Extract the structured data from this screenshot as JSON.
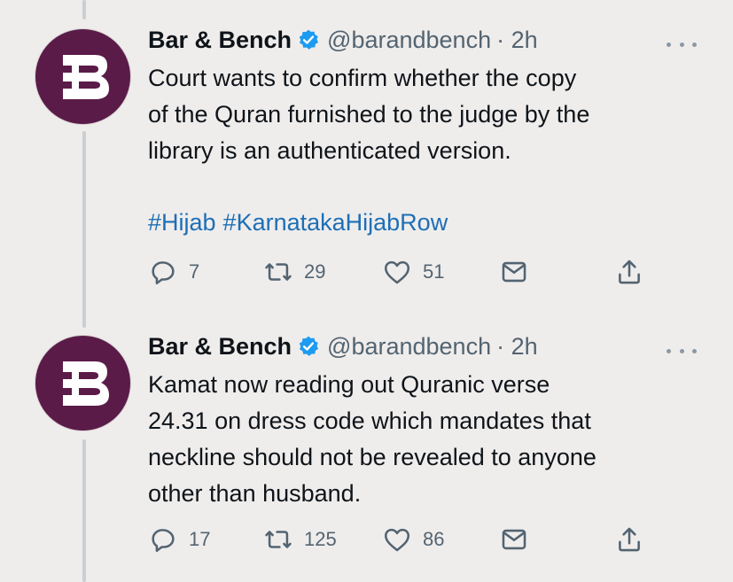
{
  "tweets": [
    {
      "author": "Bar & Bench",
      "handle": "@barandbench",
      "time": "· 2h",
      "text": "Court wants to confirm whether the copy\nof the Quran furnished to the judge by the\nlibrary is an authenticated version.",
      "hashtags": [
        "#Hijab",
        "#KarnatakaHijabRow"
      ],
      "replies": "7",
      "retweets": "29",
      "likes": "51"
    },
    {
      "author": "Bar & Bench",
      "handle": "@barandbench",
      "time": "· 2h",
      "text": "Kamat now reading out Quranic verse\n24.31 on dress code which mandates that\nneckline should not be revealed to anyone\nother than husband.",
      "hashtags": [],
      "replies": "17",
      "retweets": "125",
      "likes": "86"
    }
  ],
  "colors": {
    "background": "#efedec",
    "avatar": "#5a1b48",
    "link": "#1d6fb5",
    "verified": "#1d9bf0",
    "muted": "#536471"
  },
  "icons": [
    "logo-b-icon",
    "verified-badge-icon",
    "more-icon",
    "reply-icon",
    "retweet-icon",
    "like-icon",
    "message-icon",
    "share-icon"
  ]
}
